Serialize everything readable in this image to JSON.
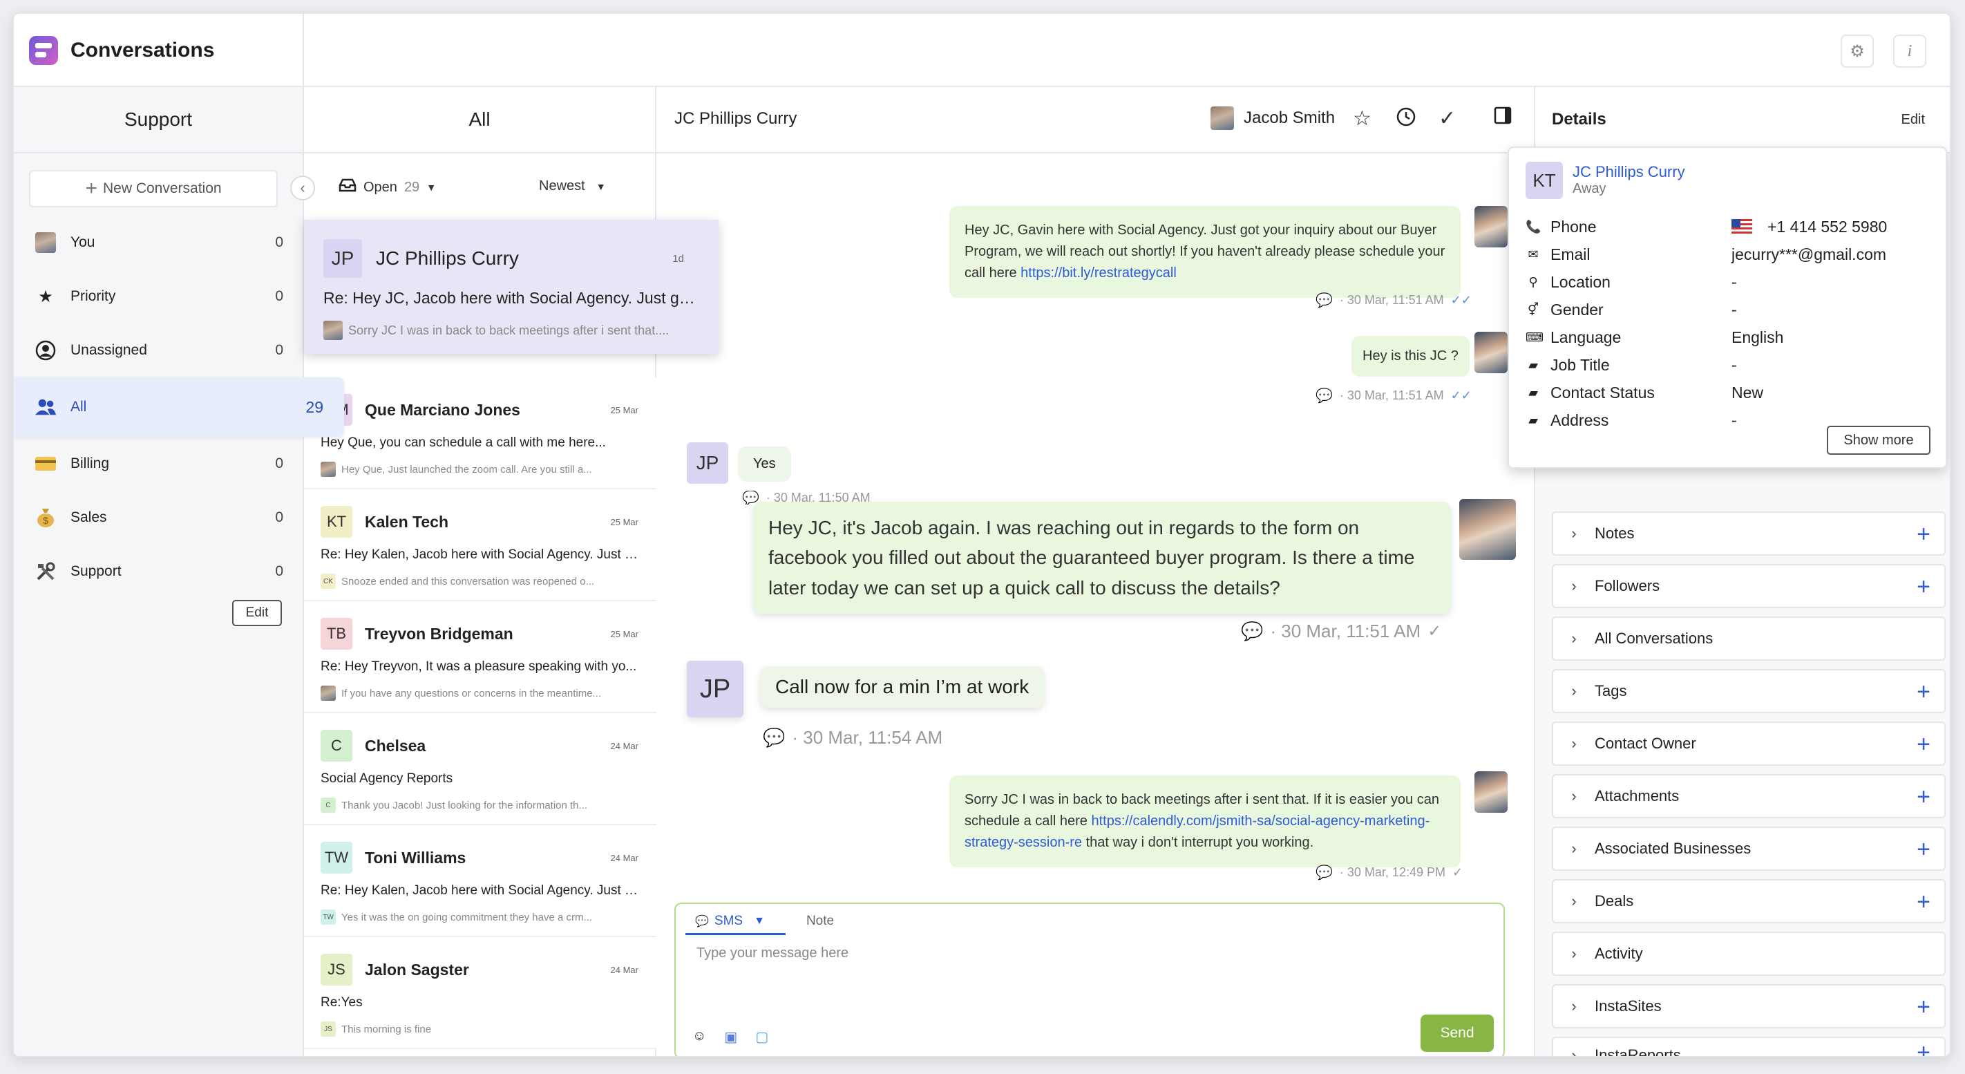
{
  "app": {
    "title": "Conversations",
    "settings_icon": "⚙",
    "info_icon": "i"
  },
  "sidebar": {
    "header": "Support",
    "new_conversation": "New Conversation",
    "items": [
      {
        "label": "You",
        "count": "0",
        "icon": "avatar"
      },
      {
        "label": "Priority",
        "count": "0",
        "icon": "star-icon"
      },
      {
        "label": "Unassigned",
        "count": "0",
        "icon": "user-circle-icon"
      },
      {
        "label": "All",
        "count": "29",
        "icon": "users-icon"
      },
      {
        "label": "Billing",
        "count": "0",
        "icon": "credit-card-icon"
      },
      {
        "label": "Sales",
        "count": "0",
        "icon": "money-bag-icon"
      },
      {
        "label": "Support",
        "count": "0",
        "icon": "tools-icon"
      }
    ],
    "edit": "Edit"
  },
  "list": {
    "header": "All",
    "filter_status": "Open",
    "filter_count": "29",
    "sort": "Newest",
    "conversations": [
      {
        "initials": "JP",
        "name": "JC Phillips Curry",
        "date": "1d",
        "subject": "Re: Hey JC, Jacob here with Social Agency. Just got...",
        "preview": "Sorry JC I was in back to back meetings after i sent that....",
        "color": "#d9d4f1"
      },
      {
        "initials": "QM",
        "name": "Que Marciano Jones",
        "date": "25 Mar",
        "subject": "Hey Que, you can schedule a call with me here...",
        "preview": "Hey Que, Just launched the zoom call. Are you still a...",
        "color": "#e7d5ef"
      },
      {
        "initials": "KT",
        "name": "Kalen Tech",
        "date": "25 Mar",
        "subject": "Re: Hey Kalen, Jacob here with Social Agency. Just g...",
        "preview": "Snooze ended and this conversation was reopened o...",
        "color": "#f1efc8",
        "mini": "CK"
      },
      {
        "initials": "TB",
        "name": "Treyvon Bridgeman",
        "date": "25 Mar",
        "subject": "Re: Hey Treyvon, It was a pleasure speaking with yo...",
        "preview": "If you have any questions or concerns in the meantime...",
        "color": "#f6d5d8"
      },
      {
        "initials": "C",
        "name": "Chelsea",
        "date": "24 Mar",
        "subject": "Social Agency Reports",
        "preview": "Thank you Jacob! Just looking for the information th...",
        "color": "#d5efd1",
        "mini": "C"
      },
      {
        "initials": "TW",
        "name": "Toni Williams",
        "date": "24 Mar",
        "subject": "Re: Hey Kalen, Jacob here with Social Agency. Just g...",
        "preview": "Yes it was the on going commitment they have a crm...",
        "color": "#d0f0ec",
        "mini": "TW"
      },
      {
        "initials": "JS",
        "name": "Jalon Sagster",
        "date": "24 Mar",
        "subject": "Re:Yes",
        "preview": "This morning is fine",
        "color": "#e4f1c8",
        "mini": "JS"
      }
    ]
  },
  "chat": {
    "title": "JC Phillips Curry",
    "agent": "Jacob Smith",
    "messages": {
      "m1_text": "Hey JC,  Gavin here with Social Agency. Just got your inquiry about our Buyer Program, we will reach out shortly! If you haven't already please schedule your call here",
      "m1_link": "https://bit.ly/restrategycall",
      "m1_meta": "· 30 Mar, 11:51 AM",
      "m2_text": "Hey is this JC ?",
      "m2_meta": "· 30 Mar, 11:51 AM",
      "m3_text": "Yes",
      "m3_meta": "· 30 Mar, 11:50 AM",
      "m4_text": "Hey JC, it's Jacob again. I was reaching out in regards to the form on facebook you filled out about the guaranteed buyer program. Is there a time later today we can set up a quick call to discuss the details?",
      "m4_meta": "· 30 Mar, 11:51 AM",
      "m5_text": "Call now for a min I’m at work",
      "m5_meta": "· 30 Mar, 11:54 AM",
      "m6_text_a": "Sorry JC I was in back to back meetings after i sent that. If it is easier you can schedule a call here",
      "m6_link": "https://calendly.com/jsmith-sa/social-agency-marketing-strategy-session-re",
      "m6_text_b": "that way i don't interrupt you working.",
      "m6_meta": "· 30 Mar, 12:49 PM"
    },
    "composer": {
      "tab_sms": "SMS",
      "tab_note": "Note",
      "placeholder": "Type your message here",
      "send": "Send"
    }
  },
  "details": {
    "header": "Details",
    "edit": "Edit",
    "contact": {
      "initials": "KT",
      "name": "JC Phillips Curry",
      "status": "Away",
      "fields": [
        {
          "label": "Phone",
          "value": "+1 414 552 5980",
          "icon": "phone-icon"
        },
        {
          "label": "Email",
          "value": "jecurry***@gmail.com",
          "icon": "mail-icon"
        },
        {
          "label": "Location",
          "value": "-",
          "icon": "pin-icon"
        },
        {
          "label": "Gender",
          "value": "-",
          "icon": "gender-icon"
        },
        {
          "label": "Language",
          "value": "English",
          "icon": "language-icon"
        },
        {
          "label": "Job Title",
          "value": "-",
          "icon": "briefcase-icon"
        },
        {
          "label": "Contact Status",
          "value": "New",
          "icon": "briefcase-icon"
        },
        {
          "label": "Address",
          "value": "-",
          "icon": "briefcase-icon"
        }
      ],
      "show_more": "Show more"
    },
    "sections": [
      {
        "label": "Notes",
        "add": true
      },
      {
        "label": "Followers",
        "add": true
      },
      {
        "label": "All Conversations",
        "add": false
      },
      {
        "label": "Tags",
        "add": true
      },
      {
        "label": "Contact Owner",
        "add": true
      },
      {
        "label": "Attachments",
        "add": true
      },
      {
        "label": "Associated Businesses",
        "add": true
      },
      {
        "label": "Deals",
        "add": true
      },
      {
        "label": "Activity",
        "add": false
      },
      {
        "label": "InstaSites",
        "add": true
      },
      {
        "label": "InstaReports",
        "add": true
      }
    ]
  },
  "colors": {
    "accent": "#2d5bd3",
    "send": "#88b642",
    "bubble": "#eaf7df"
  }
}
